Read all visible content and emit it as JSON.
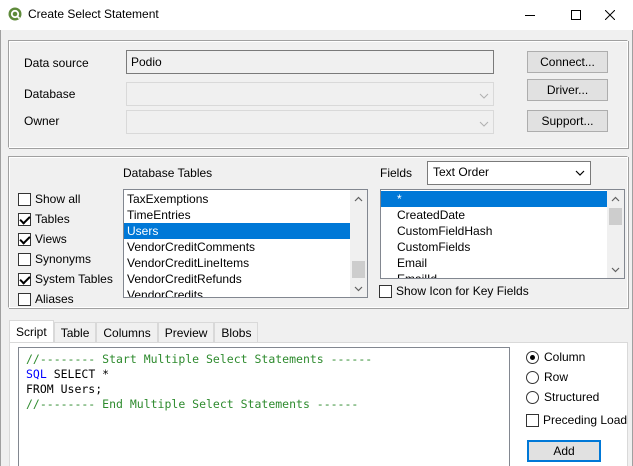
{
  "window": {
    "title": "Create Select Statement"
  },
  "connection": {
    "data_source_label": "Data source",
    "data_source_value": "Podio",
    "database_label": "Database",
    "database_value": "",
    "owner_label": "Owner",
    "owner_value": "",
    "connect_button": "Connect...",
    "driver_button": "Driver...",
    "support_button": "Support..."
  },
  "filters": [
    {
      "label": "Show all",
      "checked": false
    },
    {
      "label": "Tables",
      "checked": true
    },
    {
      "label": "Views",
      "checked": true
    },
    {
      "label": "Synonyms",
      "checked": false
    },
    {
      "label": "System Tables",
      "checked": true
    },
    {
      "label": "Aliases",
      "checked": false
    }
  ],
  "database_tables": {
    "label": "Database Tables",
    "items": [
      "TaxExemptions",
      "TimeEntries",
      "Users",
      "VendorCreditComments",
      "VendorCreditLineItems",
      "VendorCreditRefunds",
      "VendorCredits"
    ],
    "selected": "Users"
  },
  "fields": {
    "label": "Fields",
    "order_value": "Text Order",
    "items": [
      "*",
      "CreatedDate",
      "CustomFieldHash",
      "CustomFields",
      "Email",
      "EmailId"
    ],
    "selected": "*",
    "show_icon_label": "Show Icon for Key Fields",
    "show_icon_checked": false
  },
  "tabs": [
    "Script",
    "Table",
    "Columns",
    "Preview",
    "Blobs"
  ],
  "active_tab": "Script",
  "script": {
    "line1": "//-------- Start Multiple Select Statements ------",
    "line2_kw": "SQL",
    "line2_rest": " SELECT *",
    "line3": "FROM Users;",
    "line4": "//-------- End Multiple Select Statements ------"
  },
  "options": {
    "radios": [
      {
        "label": "Column",
        "checked": true
      },
      {
        "label": "Row",
        "checked": false
      },
      {
        "label": "Structured",
        "checked": false
      }
    ],
    "preceding_load_label": "Preceding Load",
    "preceding_load_checked": false,
    "add_button": "Add"
  },
  "colors": {
    "selection": "#0078d7",
    "comment": "#2e8b2e",
    "keyword": "#0000ff"
  }
}
